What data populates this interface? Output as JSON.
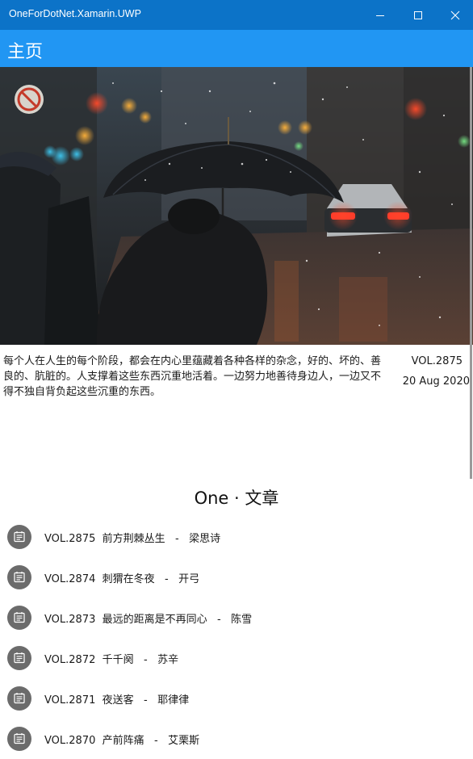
{
  "window": {
    "title": "OneForDotNet.Xamarin.UWP"
  },
  "appbar": {
    "title": "主页"
  },
  "hero": {
    "description": "Rainy city street at dusk, person holding a black umbrella, blurred traffic lights and car headlights"
  },
  "daily": {
    "quote": "每个人在人生的每个阶段，都会在内心里蕴藏着各种各样的杂念，好的、坏的、善良的、肮脏的。人支撑着这些东西沉重地活着。一边努力地善待身边人，一边又不得不独自背负起这些沉重的东西。",
    "vol": "VOL.2875",
    "date": "20 Aug 2020"
  },
  "articles": {
    "section_title": "One · 文章",
    "icon": "article-icon",
    "items": [
      {
        "vol": "VOL.2875",
        "title": "前方荆棘丛生",
        "author": "梁思诗"
      },
      {
        "vol": "VOL.2874",
        "title": "刺猬在冬夜",
        "author": "开弓"
      },
      {
        "vol": "VOL.2873",
        "title": "最远的距离是不再同心",
        "author": "陈雪"
      },
      {
        "vol": "VOL.2872",
        "title": "千千阕",
        "author": "苏辛"
      },
      {
        "vol": "VOL.2871",
        "title": "夜送客",
        "author": "耶律律"
      },
      {
        "vol": "VOL.2870",
        "title": "产前阵痛",
        "author": "艾栗斯"
      }
    ]
  },
  "colors": {
    "titlebar": "#0c73c8",
    "appbar": "#2196f3",
    "icon_bg": "#6b6b6b"
  }
}
